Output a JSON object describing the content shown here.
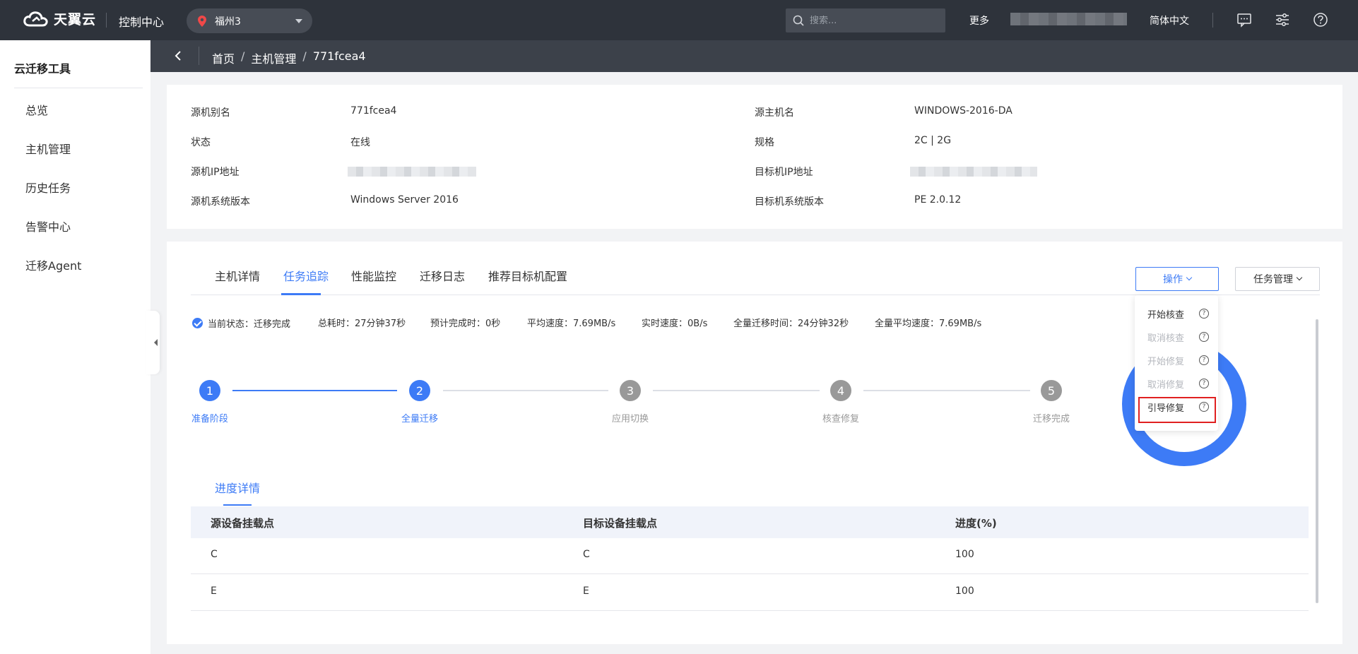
{
  "header": {
    "brand": "天翼云",
    "console": "控制中心",
    "region": "福州3",
    "search_placeholder": "搜索...",
    "more": "更多",
    "language": "简体中文",
    "icons": [
      "message-icon",
      "settings-sliders-icon",
      "help-icon"
    ]
  },
  "sidebar": {
    "title": "云迁移工具",
    "items": [
      {
        "label": "总览"
      },
      {
        "label": "主机管理"
      },
      {
        "label": "历史任务"
      },
      {
        "label": "告警中心"
      },
      {
        "label": "迁移Agent"
      }
    ]
  },
  "breadcrumb": [
    "首页",
    "主机管理",
    "771fcea4"
  ],
  "breadcrumb_sep": "/",
  "info": {
    "left": [
      {
        "label": "源机别名",
        "value": "771fcea4"
      },
      {
        "label": "状态",
        "value": "在线"
      },
      {
        "label": "源机IP地址",
        "value": ""
      },
      {
        "label": "源机系统版本",
        "value": "Windows Server 2016"
      }
    ],
    "right": [
      {
        "label": "源主机名",
        "value": "WINDOWS-2016-DA"
      },
      {
        "label": "规格",
        "value": "2C | 2G"
      },
      {
        "label": "目标机IP地址",
        "value": ""
      },
      {
        "label": "目标机系统版本",
        "value": "PE 2.0.12"
      }
    ]
  },
  "tabs": [
    {
      "label": "主机详情"
    },
    {
      "label": "任务追踪",
      "active": true
    },
    {
      "label": "性能监控"
    },
    {
      "label": "迁移日志"
    },
    {
      "label": "推荐目标机配置"
    }
  ],
  "buttons": {
    "operation": "操作",
    "task_mgmt": "任务管理"
  },
  "status": {
    "current": "当前状态：迁移完成",
    "total_time": "总耗时：27分钟37秒",
    "eta": "预计完成时：0秒",
    "avg_speed": "平均速度：7.69MB/s",
    "realtime_speed": "实时速度：0B/s",
    "full_time": "全量迁移时间：24分钟32秒",
    "full_avg_speed": "全量平均速度：7.69MB/s"
  },
  "steps": [
    {
      "num": "1",
      "label": "准备阶段",
      "state": "done"
    },
    {
      "num": "2",
      "label": "全量迁移",
      "state": "active"
    },
    {
      "num": "3",
      "label": "应用切换",
      "state": "pending"
    },
    {
      "num": "4",
      "label": "核查修复",
      "state": "pending"
    },
    {
      "num": "5",
      "label": "迁移完成",
      "state": "pending"
    }
  ],
  "menu": [
    {
      "label": "开始核查",
      "enabled": true
    },
    {
      "label": "取消核查",
      "enabled": false
    },
    {
      "label": "开始修复",
      "enabled": false
    },
    {
      "label": "取消修复",
      "enabled": false
    },
    {
      "label": "引导修复",
      "enabled": true,
      "highlighted": true
    }
  ],
  "menu_help_glyph": "?",
  "progress": {
    "tab": "进度详情",
    "columns": [
      "源设备挂载点",
      "目标设备挂载点",
      "进度(%)"
    ],
    "rows": [
      [
        "C",
        "C",
        "100"
      ],
      [
        "E",
        "E",
        "100"
      ]
    ]
  },
  "colors": {
    "accent": "#3d7bf6",
    "topbar": "#2e333b",
    "highlight": "#e02020"
  }
}
